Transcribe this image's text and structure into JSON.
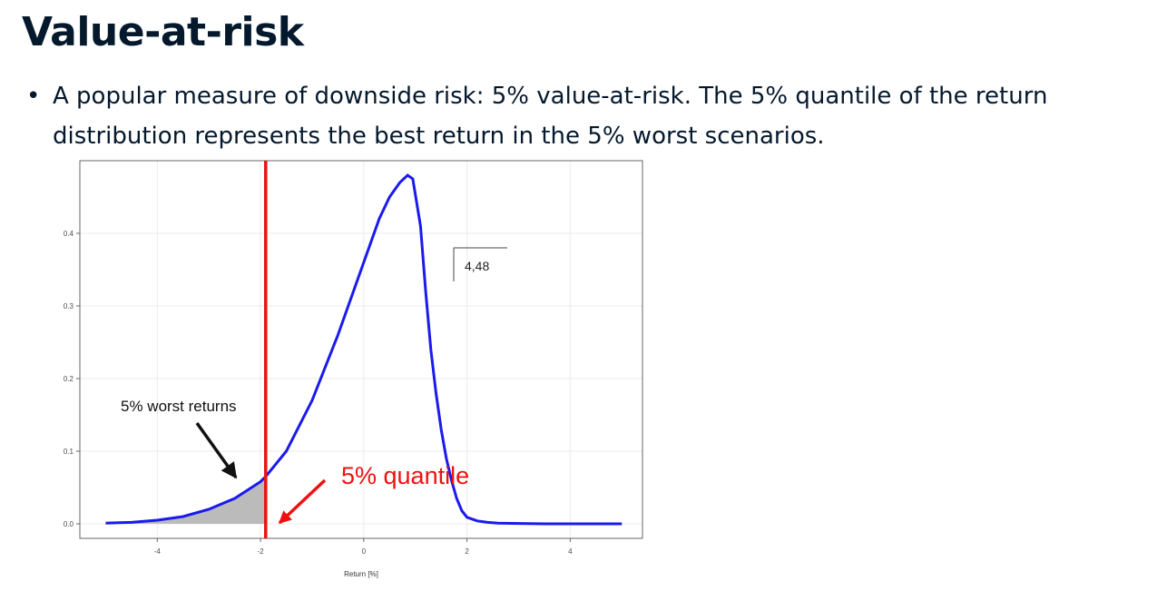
{
  "slide": {
    "title": "Value-at-risk",
    "bullet_marker": "•",
    "bullets": [
      "A popular measure of downside risk: 5% value-at-risk. The 5% quantile of the return distribution represents the best return in the 5% worst scenarios."
    ]
  },
  "chart_data": {
    "type": "line",
    "xlabel": "Return [%]",
    "ylabel": "",
    "xlim": [
      -5.5,
      5.4
    ],
    "ylim": [
      -0.02,
      0.5
    ],
    "xticks": [
      -4,
      -2,
      0,
      2,
      4
    ],
    "yticks": [
      0.0,
      0.1,
      0.2,
      0.3,
      0.4
    ],
    "xtick_labels": [
      "-4",
      "-2",
      "0",
      "2",
      "4"
    ],
    "ytick_labels": [
      "0.0",
      "0.1",
      "0.2",
      "0.3",
      "0.4"
    ],
    "grid": true,
    "series": [
      {
        "color": "#1a1aee",
        "x": [
          -5.0,
          -4.5,
          -4.0,
          -3.5,
          -3.0,
          -2.5,
          -2.0,
          -1.9,
          -1.5,
          -1.0,
          -0.5,
          0.0,
          0.3,
          0.5,
          0.7,
          0.85,
          0.95,
          1.1,
          1.2,
          1.3,
          1.4,
          1.5,
          1.6,
          1.7,
          1.8,
          1.9,
          2.0,
          2.2,
          2.4,
          2.6,
          3.0,
          3.5,
          4.0,
          4.5,
          5.0
        ],
        "y": [
          0.001,
          0.002,
          0.005,
          0.01,
          0.02,
          0.035,
          0.058,
          0.065,
          0.1,
          0.17,
          0.26,
          0.36,
          0.42,
          0.45,
          0.47,
          0.48,
          0.475,
          0.41,
          0.32,
          0.24,
          0.18,
          0.13,
          0.09,
          0.06,
          0.035,
          0.018,
          0.009,
          0.004,
          0.002,
          0.001,
          0.0005,
          0.0,
          0.0,
          0.0,
          0.0
        ]
      }
    ],
    "shaded_region": {
      "label": "5% worst returns",
      "x_to": -1.9,
      "color": "#bbbbbb"
    },
    "vertical_line": {
      "x": -1.9,
      "color": "#ee1111",
      "label": "5% quantile"
    },
    "annotation_box": {
      "text": "4,48"
    }
  }
}
